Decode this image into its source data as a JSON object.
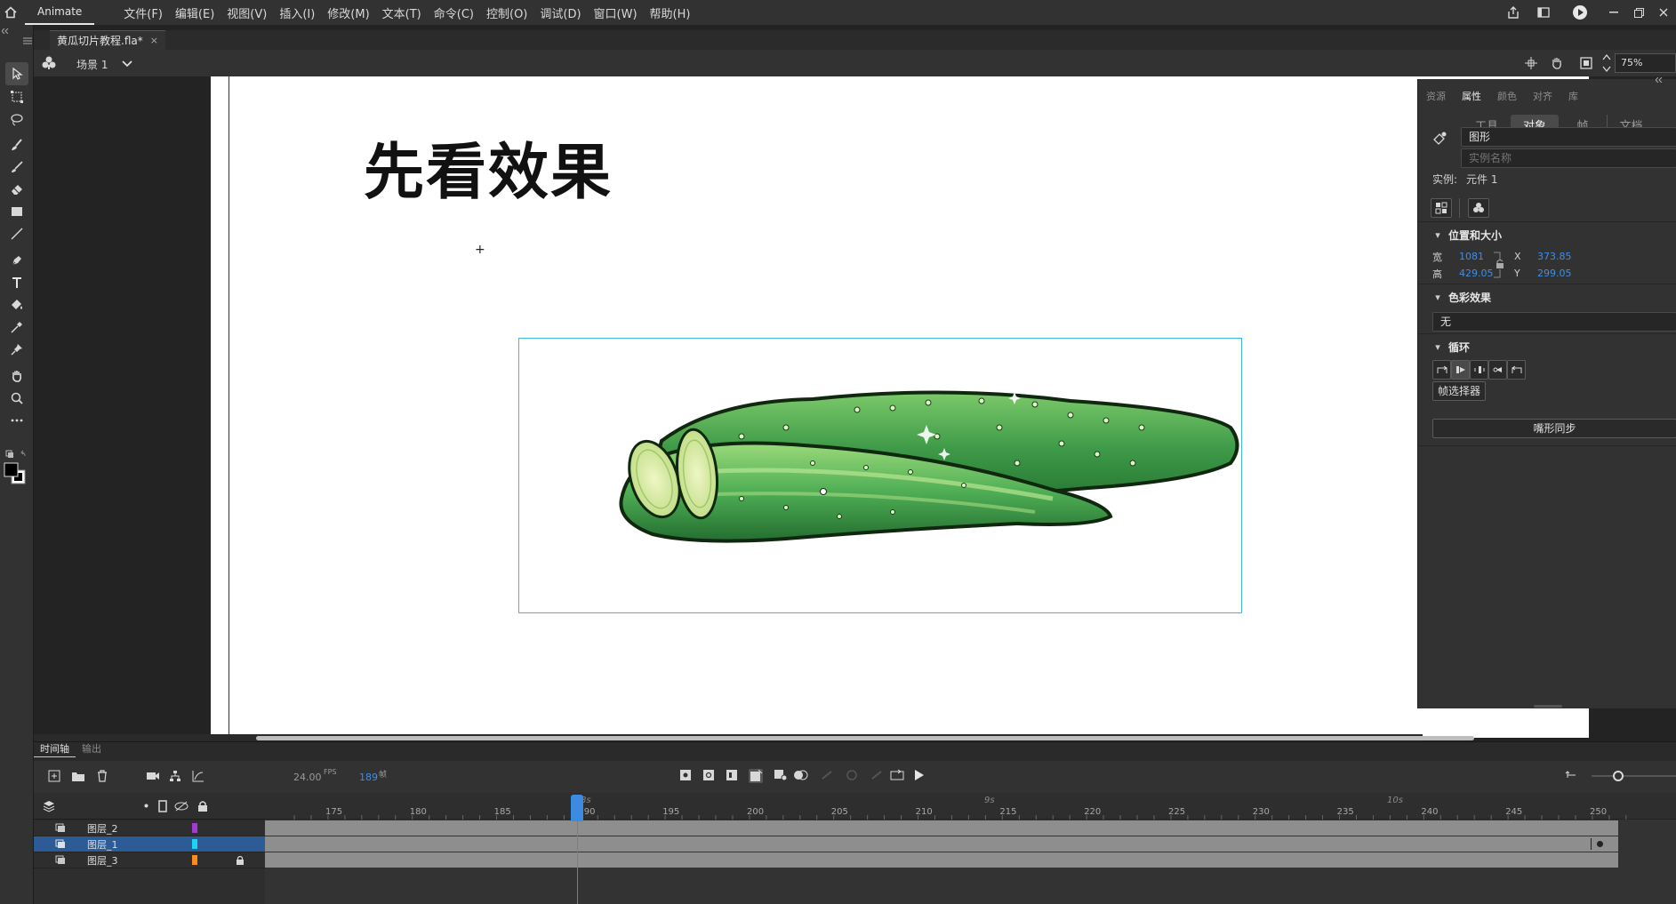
{
  "menubar": {
    "app_label": "Animate",
    "menus": [
      "文件(F)",
      "编辑(E)",
      "视图(V)",
      "插入(I)",
      "修改(M)",
      "文本(T)",
      "命令(C)",
      "控制(O)",
      "调试(D)",
      "窗口(W)",
      "帮助(H)"
    ]
  },
  "document": {
    "tab_title": "黄瓜切片教程.fla*",
    "tab_close": "×"
  },
  "scenebar": {
    "scene_label": "场景 1",
    "zoom": "75%"
  },
  "stage": {
    "heading": "先看效果"
  },
  "props": {
    "tabs": [
      "资源",
      "属性",
      "颜色",
      "对齐",
      "库"
    ],
    "active_tab": "属性",
    "segments": [
      "工具",
      "对象",
      "帧",
      "文档"
    ],
    "active_segment": "对象",
    "symbol_type": "图形",
    "instance_name_placeholder": "实例名称",
    "instance_label": "实例:",
    "instance_value": "元件 1",
    "position_size": {
      "title": "位置和大小",
      "w_label": "宽",
      "w_value": "1081",
      "h_label": "高",
      "h_value": "429.05",
      "x_label": "X",
      "x_value": "373.85",
      "y_label": "Y",
      "y_value": "299.05"
    },
    "color_effect": {
      "title": "色彩效果",
      "value": "无"
    },
    "loop": {
      "title": "循环",
      "frame_picker": "帧选择器",
      "lip_sync": "嘴形同步"
    }
  },
  "timeline": {
    "tabs": [
      "时间轴",
      "输出"
    ],
    "active_tab": "时间轴",
    "fps": "24.00",
    "fps_unit": "FPS",
    "current_frame": "189",
    "frame_unit": "帧",
    "ruler_ticks": [
      "175",
      "180",
      "185",
      "190",
      "195",
      "200",
      "205",
      "210",
      "215",
      "220",
      "225",
      "230",
      "235",
      "240",
      "245",
      "250"
    ],
    "seconds_marks": [
      "8s",
      "9s",
      "10s"
    ],
    "layers": [
      {
        "name": "图层_2",
        "color": "#a23bd1",
        "selected": false,
        "locked": false
      },
      {
        "name": "图层_1",
        "color": "#1ed2f0",
        "selected": true,
        "locked": false
      },
      {
        "name": "图层_3",
        "color": "#ff8a1e",
        "selected": false,
        "locked": true
      }
    ]
  }
}
